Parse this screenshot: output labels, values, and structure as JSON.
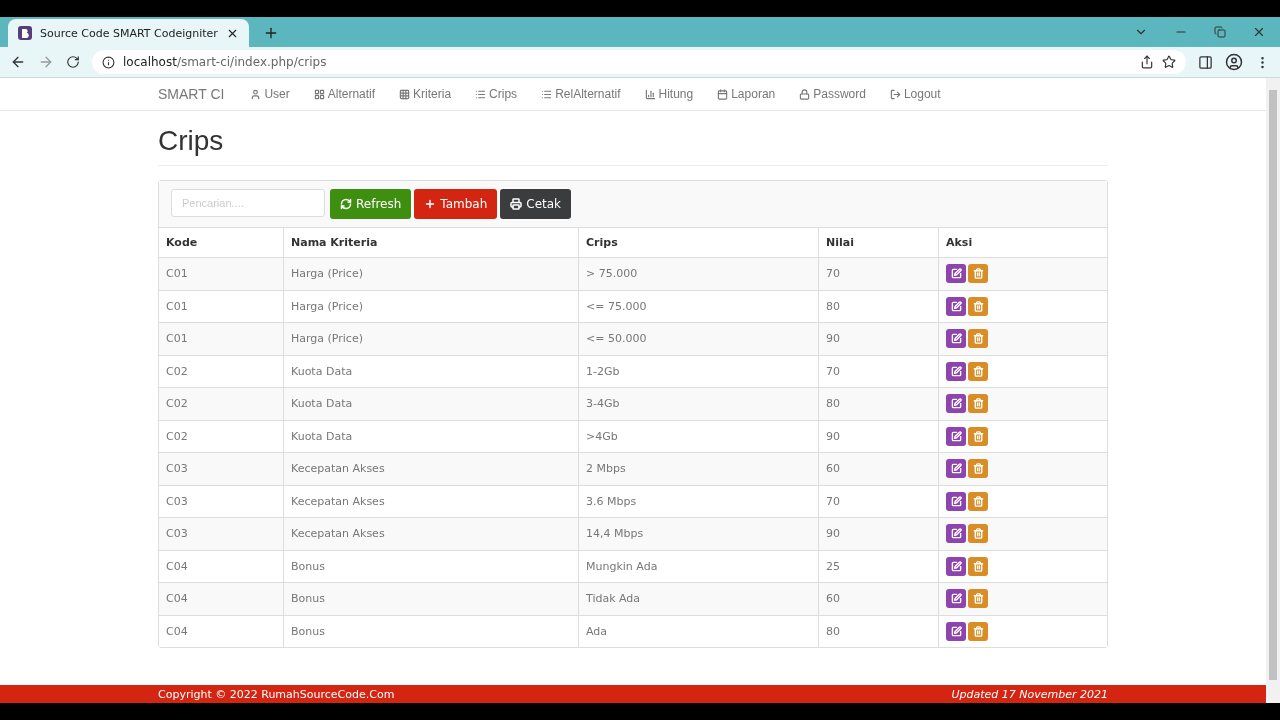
{
  "browser": {
    "tab_title": "Source Code SMART Codeigniter",
    "url_host": "localhost",
    "url_path": "/smart-ci/index.php/crips"
  },
  "navbar": {
    "brand": "SMART CI",
    "items": [
      {
        "label": "User"
      },
      {
        "label": "Alternatif"
      },
      {
        "label": "Kriteria"
      },
      {
        "label": "Crips"
      },
      {
        "label": "RelAlternatif"
      },
      {
        "label": "Hitung"
      },
      {
        "label": "Laporan"
      },
      {
        "label": "Password"
      },
      {
        "label": "Logout"
      }
    ]
  },
  "page_title": "Crips",
  "search": {
    "placeholder": "Pencarian...."
  },
  "buttons": [
    {
      "label": "Refresh",
      "kind": "refresh"
    },
    {
      "label": "Tambah",
      "kind": "add"
    },
    {
      "label": "Cetak",
      "kind": "print"
    }
  ],
  "table": {
    "columns": [
      "Kode",
      "Nama Kriteria",
      "Crips",
      "Nilai",
      "Aksi"
    ],
    "rows": [
      [
        "C01",
        "Harga (Price)",
        "> 75.000",
        "70"
      ],
      [
        "C01",
        "Harga (Price)",
        "<= 75.000",
        "80"
      ],
      [
        "C01",
        "Harga (Price)",
        "<= 50.000",
        "90"
      ],
      [
        "C02",
        "Kuota Data",
        "1-2Gb",
        "70"
      ],
      [
        "C02",
        "Kuota Data",
        "3-4Gb",
        "80"
      ],
      [
        "C02",
        "Kuota Data",
        ">4Gb",
        "90"
      ],
      [
        "C03",
        "Kecepatan Akses",
        "2 Mbps",
        "60"
      ],
      [
        "C03",
        "Kecepatan Akses",
        "3.6 Mbps",
        "70"
      ],
      [
        "C03",
        "Kecepatan Akses",
        "14,4 Mbps",
        "90"
      ],
      [
        "C04",
        "Bonus",
        "Mungkin Ada",
        "25"
      ],
      [
        "C04",
        "Bonus",
        "Tidak Ada",
        "60"
      ],
      [
        "C04",
        "Bonus",
        "Ada",
        "80"
      ]
    ]
  },
  "footer": {
    "left": "Copyright © 2022 RumahSourceCode.Com",
    "right": "Updated 17 November 2021"
  }
}
